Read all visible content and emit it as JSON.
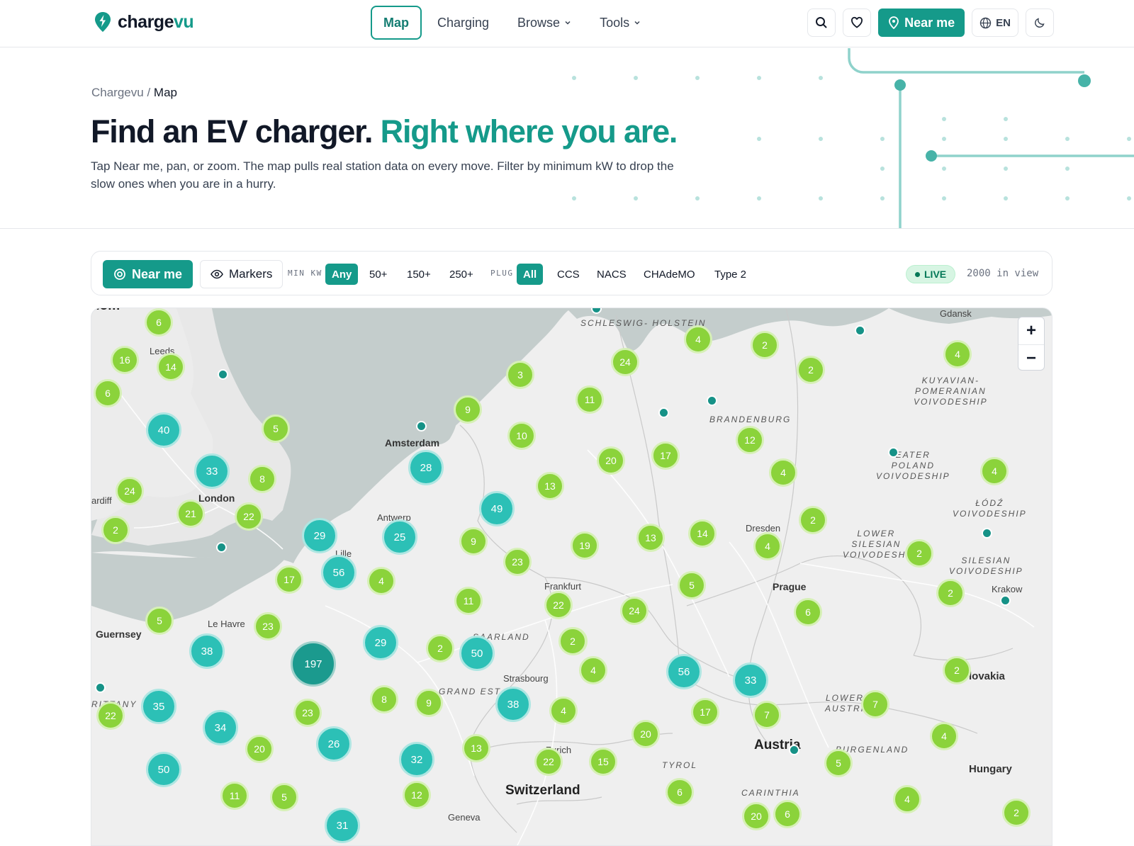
{
  "brand": {
    "name_main": "charge",
    "name_accent": "vu"
  },
  "nav": {
    "links": [
      {
        "label": "Map",
        "active": true,
        "dropdown": false
      },
      {
        "label": "Charging",
        "active": false,
        "dropdown": false
      },
      {
        "label": "Browse",
        "active": false,
        "dropdown": true
      },
      {
        "label": "Tools",
        "active": false,
        "dropdown": true
      }
    ],
    "near_me": "Near me",
    "lang": "EN"
  },
  "breadcrumb": {
    "root": "Chargevu",
    "sep": "/",
    "current": "Map"
  },
  "hero": {
    "headline_main": "Find an EV charger.",
    "headline_accent": "Right where you are.",
    "lede": "Tap Near me, pan, or zoom. The map pulls real station data on every move. Filter by minimum kW to drop the slow ones when you are in a hurry."
  },
  "filters": {
    "near_me": "Near me",
    "markers": "Markers",
    "min_kw_label": "MIN KW",
    "kw_options": [
      "Any",
      "50+",
      "150+",
      "250+"
    ],
    "kw_selected": "Any",
    "plug_label": "PLUG",
    "plug_options": [
      "All",
      "CCS",
      "NACS",
      "CHAdeMO",
      "Type 2"
    ],
    "plug_selected": "All",
    "live": "LIVE",
    "in_view": "2000 in view"
  },
  "map": {
    "zoom_in": "+",
    "zoom_out": "−",
    "colors": {
      "small": "#8bd33b",
      "medium": "#2cc0b6",
      "large": "#1b9a8e",
      "station": "#169287",
      "water": "#c4cdcc"
    },
    "labels": {
      "gdansk": "Gdansk",
      "leeds": "Leeds",
      "amsterdam": "Amsterdam",
      "london": "London",
      "cardiff": "ardiff",
      "antwerp": "Antwerp",
      "lille": "Lille",
      "dresden": "Dresden",
      "frankfurt": "Frankfurt",
      "prague": "Prague",
      "krakow": "Krakow",
      "guernsey": "Guernsey",
      "le_havre": "Le Havre",
      "strasbourg": "Strasbourg",
      "slovakia": "lovakia",
      "austria": "Austria",
      "zurich": "Zurich",
      "switzerland": "Switzerland",
      "hungary": "Hungary",
      "geneva": "Geneva",
      "schleswig": "SCHLESWIG-\nHOLSTEIN",
      "brandenburg": "BRANDENBURG",
      "kuyavian": "KUYAVIAN-\nPOMERANIAN\nVOIVODESHIP",
      "greater_poland": "EATER\nPOLAND\nVOIVODESHIP",
      "lodz": "ŁÓDŹ\nVOIVODESHIP",
      "lower_silesian": "LOWER\nSILESIAN\nVOIVODESHI",
      "silesian": "SILESIAN\nVOIVODESHIP",
      "saarland": "SAARLAND",
      "grand_est": "GRAND EST",
      "lower_austria": "LOWER\nAUSTRI",
      "burgenland": "BURGENLAND",
      "tyrol": "TYROL",
      "carinthia": "CARINTHIA",
      "brittany": "RITTANY",
      "london_top": "dom"
    },
    "clusters": [
      {
        "v": "6",
        "s": "sm"
      },
      {
        "v": "16",
        "s": "sm"
      },
      {
        "v": "14",
        "s": "sm"
      },
      {
        "v": "6",
        "s": "sm"
      },
      {
        "v": "40",
        "s": "md"
      },
      {
        "v": "5",
        "s": "sm"
      },
      {
        "v": "33",
        "s": "md"
      },
      {
        "v": "8",
        "s": "sm"
      },
      {
        "v": "24",
        "s": "sm"
      },
      {
        "v": "21",
        "s": "sm"
      },
      {
        "v": "22",
        "s": "sm"
      },
      {
        "v": "2",
        "s": "sm"
      },
      {
        "v": "3",
        "s": "sm"
      },
      {
        "v": "9",
        "s": "sm"
      },
      {
        "v": "10",
        "s": "sm"
      },
      {
        "v": "28",
        "s": "md"
      },
      {
        "v": "11",
        "s": "sm"
      },
      {
        "v": "24",
        "s": "sm"
      },
      {
        "v": "4",
        "s": "sm"
      },
      {
        "v": "2",
        "s": "sm"
      },
      {
        "v": "2",
        "s": "sm"
      },
      {
        "v": "4",
        "s": "sm"
      },
      {
        "v": "20",
        "s": "sm"
      },
      {
        "v": "17",
        "s": "sm"
      },
      {
        "v": "12",
        "s": "sm"
      },
      {
        "v": "4",
        "s": "sm"
      },
      {
        "v": "4",
        "s": "sm"
      },
      {
        "v": "13",
        "s": "sm"
      },
      {
        "v": "49",
        "s": "md"
      },
      {
        "v": "29",
        "s": "md"
      },
      {
        "v": "25",
        "s": "md"
      },
      {
        "v": "9",
        "s": "sm"
      },
      {
        "v": "56",
        "s": "md"
      },
      {
        "v": "23",
        "s": "sm"
      },
      {
        "v": "19",
        "s": "sm"
      },
      {
        "v": "13",
        "s": "sm"
      },
      {
        "v": "14",
        "s": "sm"
      },
      {
        "v": "2",
        "s": "sm"
      },
      {
        "v": "4",
        "s": "sm"
      },
      {
        "v": "2",
        "s": "sm"
      },
      {
        "v": "4",
        "s": "sm"
      },
      {
        "v": "17",
        "s": "sm"
      },
      {
        "v": "11",
        "s": "sm"
      },
      {
        "v": "22",
        "s": "sm"
      },
      {
        "v": "5",
        "s": "sm"
      },
      {
        "v": "24",
        "s": "sm"
      },
      {
        "v": "6",
        "s": "sm"
      },
      {
        "v": "2",
        "s": "sm"
      },
      {
        "v": "5",
        "s": "sm"
      },
      {
        "v": "23",
        "s": "sm"
      },
      {
        "v": "38",
        "s": "md"
      },
      {
        "v": "197",
        "s": "lg"
      },
      {
        "v": "29",
        "s": "md"
      },
      {
        "v": "2",
        "s": "sm"
      },
      {
        "v": "50",
        "s": "md"
      },
      {
        "v": "2",
        "s": "sm"
      },
      {
        "v": "4",
        "s": "sm"
      },
      {
        "v": "56",
        "s": "md"
      },
      {
        "v": "33",
        "s": "md"
      },
      {
        "v": "2",
        "s": "sm"
      },
      {
        "v": "2",
        "s": "sm"
      },
      {
        "v": "22",
        "s": "sm"
      },
      {
        "v": "35",
        "s": "md"
      },
      {
        "v": "34",
        "s": "md"
      },
      {
        "v": "23",
        "s": "sm"
      },
      {
        "v": "8",
        "s": "sm"
      },
      {
        "v": "9",
        "s": "sm"
      },
      {
        "v": "38",
        "s": "md"
      },
      {
        "v": "4",
        "s": "sm"
      },
      {
        "v": "17",
        "s": "sm"
      },
      {
        "v": "7",
        "s": "sm"
      },
      {
        "v": "7",
        "s": "sm"
      },
      {
        "v": "20",
        "s": "sm"
      },
      {
        "v": "26",
        "s": "md"
      },
      {
        "v": "13",
        "s": "sm"
      },
      {
        "v": "20",
        "s": "sm"
      },
      {
        "v": "4",
        "s": "sm"
      },
      {
        "v": "50",
        "s": "md"
      },
      {
        "v": "32",
        "s": "md"
      },
      {
        "v": "22",
        "s": "sm"
      },
      {
        "v": "15",
        "s": "sm"
      },
      {
        "v": "5",
        "s": "sm"
      },
      {
        "v": "11",
        "s": "sm"
      },
      {
        "v": "5",
        "s": "sm"
      },
      {
        "v": "12",
        "s": "sm"
      },
      {
        "v": "6",
        "s": "sm"
      },
      {
        "v": "4",
        "s": "sm"
      },
      {
        "v": "20",
        "s": "sm"
      },
      {
        "v": "6",
        "s": "sm"
      },
      {
        "v": "2",
        "s": "sm"
      },
      {
        "v": "31",
        "s": "md"
      }
    ]
  }
}
